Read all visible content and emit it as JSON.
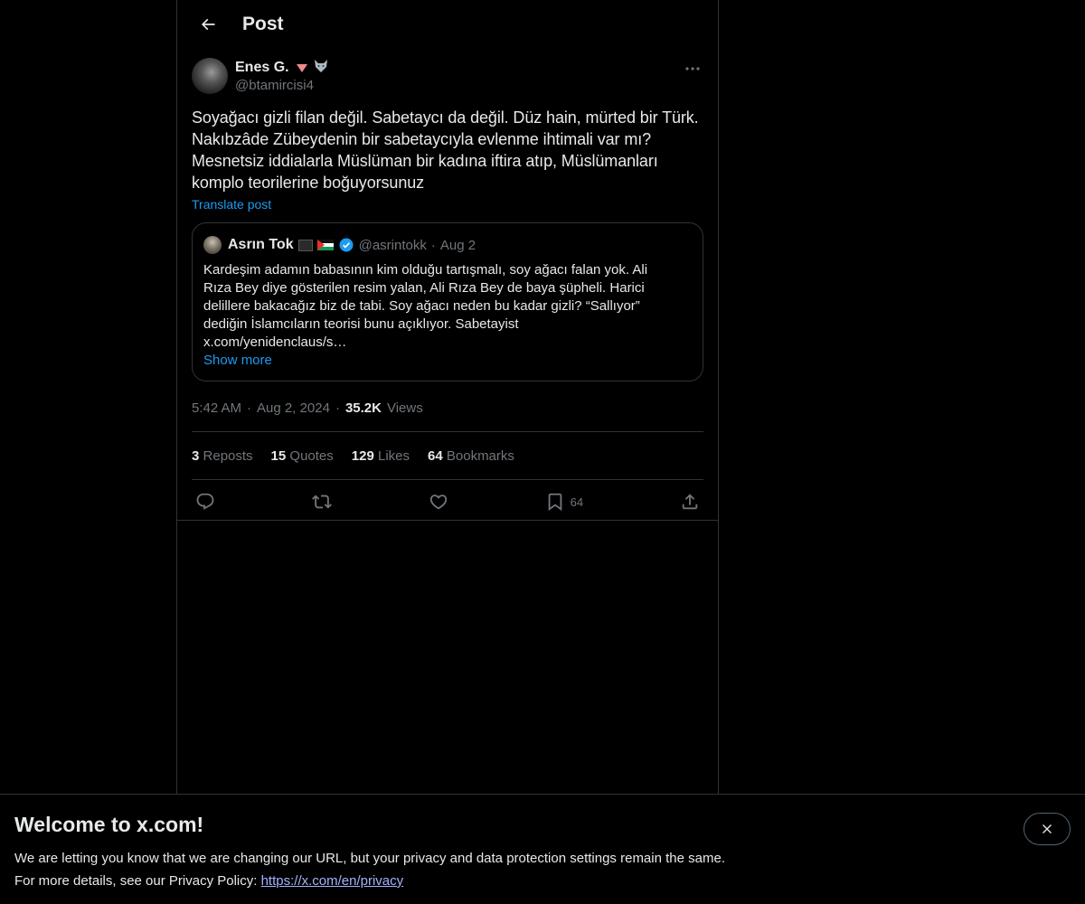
{
  "header": {
    "title": "Post",
    "back_icon": "arrow-left-icon"
  },
  "post": {
    "author_name": "Enes G.",
    "author_handle": "@btamircisi4",
    "text": "Soyağacı gizli filan değil. Sabetaycı da değil. Düz hain, mürted bir Türk.\nNakıbzâde Zübeydenin bir sabetaycıyla evlenme ihtimali var mı?\nMesnetsiz iddialarla Müslüman bir kadına iftira atıp, Müslümanları\nkomplo teorilerine boğuyorsunuz",
    "translate_label": "Translate post",
    "time": "5:42 AM",
    "date": "Aug 2, 2024",
    "views_count": "35.2K",
    "views_label": "Views"
  },
  "quote": {
    "author_name": "Asrın Tok",
    "author_handle": "@asrintokk",
    "date": "Aug 2",
    "text": "Kardeşim adamın babasının kim olduğu tartışmalı, soy ağacı falan yok. Ali\nRıza Bey diye gösterilen resim yalan, Ali Rıza Bey de baya şüpheli. Harici\ndelillere bakacağız biz de tabi. Soy ağacı neden bu kadar gizli? “Sallıyor”\ndediğin İslamcıların teorisi bunu açıklıyor. Sabetayist\nx.com/yenidenclaus/s…",
    "show_more": "Show more"
  },
  "stats": {
    "reposts_count": "3",
    "reposts_label": "Reposts",
    "quotes_count": "15",
    "quotes_label": "Quotes",
    "likes_count": "129",
    "likes_label": "Likes",
    "bookmarks_count": "64",
    "bookmarks_label": "Bookmarks"
  },
  "actions": {
    "bookmark_count": "64"
  },
  "banner": {
    "title": "Welcome to x.com!",
    "line1": "We are letting you know that we are changing our URL, but your privacy and data protection settings remain the same.",
    "line2_prefix": "For more details, see our Privacy Policy: ",
    "link": "https://x.com/en/privacy"
  },
  "colors": {
    "accent": "#1d9bf0",
    "background": "#000000",
    "text": "#e7e9ea",
    "muted": "#71767b",
    "border": "#2f3336"
  }
}
